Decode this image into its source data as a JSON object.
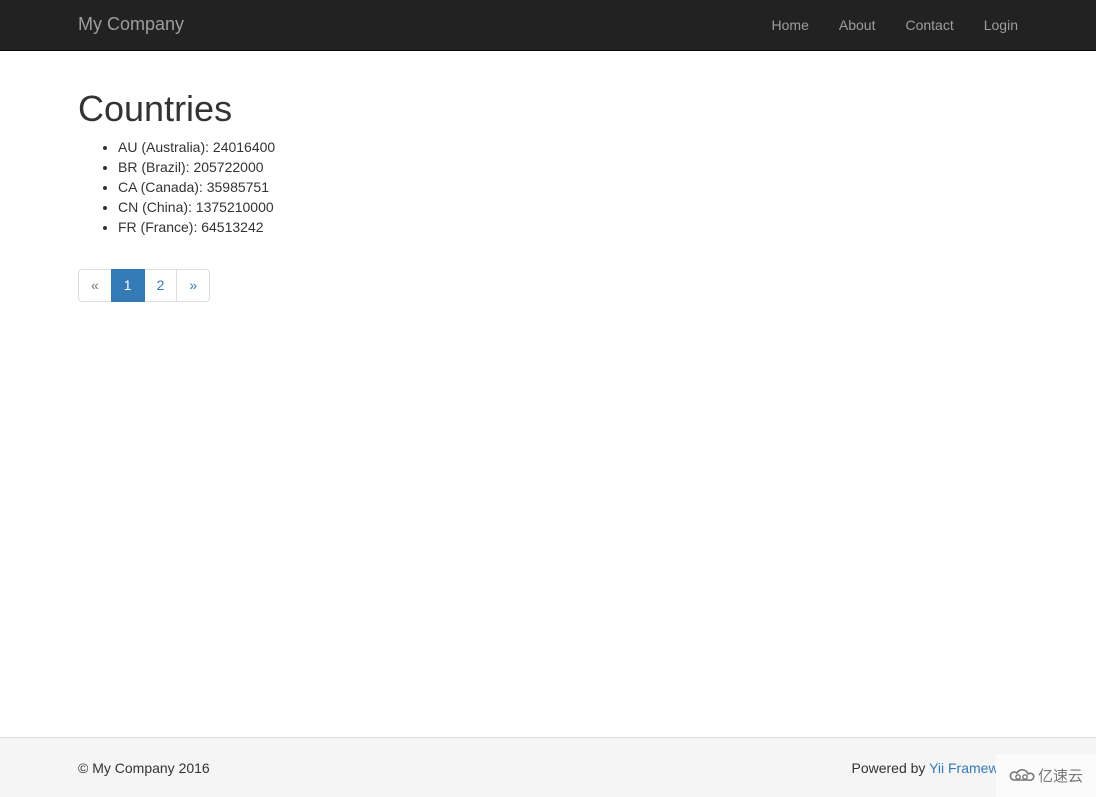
{
  "navbar": {
    "brand": "My Company",
    "items": [
      {
        "label": "Home"
      },
      {
        "label": "About"
      },
      {
        "label": "Contact"
      },
      {
        "label": "Login"
      }
    ]
  },
  "main": {
    "title": "Countries",
    "countries": [
      {
        "text": "AU (Australia): 24016400"
      },
      {
        "text": "BR (Brazil): 205722000"
      },
      {
        "text": "CA (Canada): 35985751"
      },
      {
        "text": "CN (China): 1375210000"
      },
      {
        "text": "FR (France): 64513242"
      }
    ],
    "pagination": {
      "prev": "«",
      "pages": [
        "1",
        "2"
      ],
      "current": "1",
      "next": "»"
    }
  },
  "footer": {
    "copyright": "© My Company 2016",
    "powered_by": "Powered by ",
    "framework_link": "Yii Framework"
  },
  "watermark": {
    "text": "亿速云",
    "icon": "cloud-logo-icon"
  },
  "colors": {
    "navbar_bg": "#222222",
    "link": "#337ab7",
    "active_page": "#337ab7"
  }
}
